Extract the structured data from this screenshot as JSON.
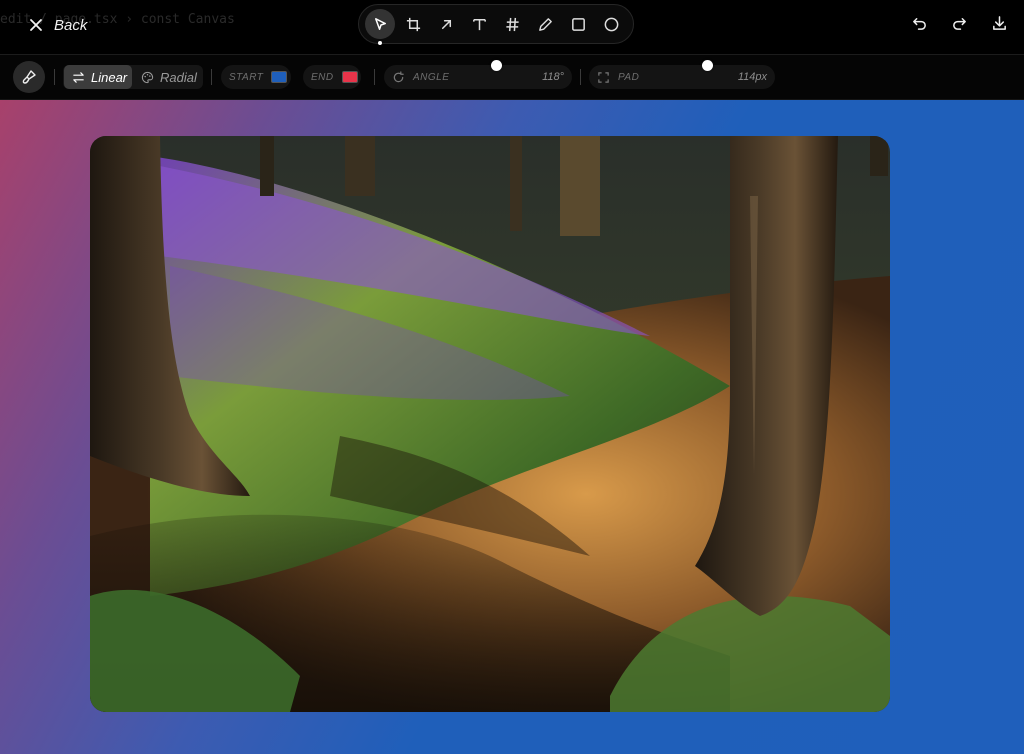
{
  "app": {
    "ghost_text": "edit  /  page.tsx  ›  const  Canvas",
    "back_label": "Back"
  },
  "toolbar": {
    "tools": [
      {
        "name": "select",
        "icon": "cursor-arrow-icon",
        "active": true
      },
      {
        "name": "crop",
        "icon": "crop-icon"
      },
      {
        "name": "arrow",
        "icon": "arrow-up-right-icon"
      },
      {
        "name": "text",
        "icon": "text-t-icon"
      },
      {
        "name": "hash",
        "icon": "hash-icon"
      },
      {
        "name": "pen",
        "icon": "pencil-icon"
      },
      {
        "name": "rectangle",
        "icon": "square-icon"
      },
      {
        "name": "ellipse",
        "icon": "circle-icon"
      }
    ],
    "actions": [
      {
        "name": "undo",
        "icon": "undo-icon"
      },
      {
        "name": "redo",
        "icon": "redo-icon"
      },
      {
        "name": "download",
        "icon": "download-icon"
      }
    ]
  },
  "options": {
    "background_brush_icon": "paint-brush-icon",
    "gradient_modes": [
      {
        "label": "Linear",
        "icon": "swap-arrows-icon",
        "selected": true
      },
      {
        "label": "Radial",
        "icon": "palette-icon",
        "selected": false
      }
    ],
    "start": {
      "label": "START",
      "color": "#1f5fbb"
    },
    "end": {
      "label": "END",
      "color": "#e8344a"
    },
    "angle": {
      "label": "ANGLE",
      "value": "118°",
      "level": 0.33
    },
    "pad": {
      "label": "PAD",
      "value": "114px",
      "level": 0.57
    }
  },
  "canvas": {
    "gradient_start": "#1f5fbb",
    "gradient_end": "#a8416b",
    "photo_subject": "bluebell forest path with tree trunks"
  }
}
